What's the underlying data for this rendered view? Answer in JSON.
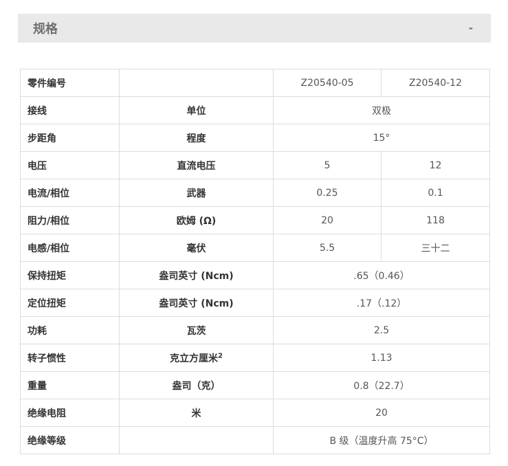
{
  "section": {
    "title": "规格",
    "toggle": "-"
  },
  "header_row": {
    "label": "零件编号",
    "unit": "",
    "models": [
      "Z20540-05",
      "Z20540-12"
    ]
  },
  "rows": [
    {
      "label": "接线",
      "unit": "单位",
      "unit_sup": "",
      "values": [
        "双极"
      ]
    },
    {
      "label": "步距角",
      "unit": "程度",
      "unit_sup": "",
      "values": [
        "15°"
      ]
    },
    {
      "label": "电压",
      "unit": "直流电压",
      "unit_sup": "",
      "values": [
        "5",
        "12"
      ]
    },
    {
      "label": "电流/相位",
      "unit": "武器",
      "unit_sup": "",
      "values": [
        "0.25",
        "0.1"
      ]
    },
    {
      "label": "阻力/相位",
      "unit": "欧姆 (Ω)",
      "unit_sup": "",
      "values": [
        "20",
        "118"
      ]
    },
    {
      "label": "电感/相位",
      "unit": "毫伏",
      "unit_sup": "",
      "values": [
        "5.5",
        "三十二"
      ]
    },
    {
      "label": "保持扭矩",
      "unit": "盎司英寸 (Ncm)",
      "unit_sup": "",
      "values": [
        ".65（0.46）"
      ]
    },
    {
      "label": "定位扭矩",
      "unit": "盎司英寸 (Ncm)",
      "unit_sup": "",
      "values": [
        ".17（.12）"
      ]
    },
    {
      "label": "功耗",
      "unit": "瓦茨",
      "unit_sup": "",
      "values": [
        "2.5"
      ]
    },
    {
      "label": "转子惯性",
      "unit": "克立方厘米",
      "unit_sup": "2",
      "values": [
        "1.13"
      ]
    },
    {
      "label": "重量",
      "unit": "盎司（克）",
      "unit_sup": "",
      "values": [
        "0.8（22.7）"
      ]
    },
    {
      "label": "绝缘电阻",
      "unit": "米",
      "unit_sup": "",
      "values": [
        "20"
      ]
    },
    {
      "label": "绝缘等级",
      "unit": "",
      "unit_sup": "",
      "values": [
        "B 级（温度升高 75°C）"
      ]
    }
  ]
}
